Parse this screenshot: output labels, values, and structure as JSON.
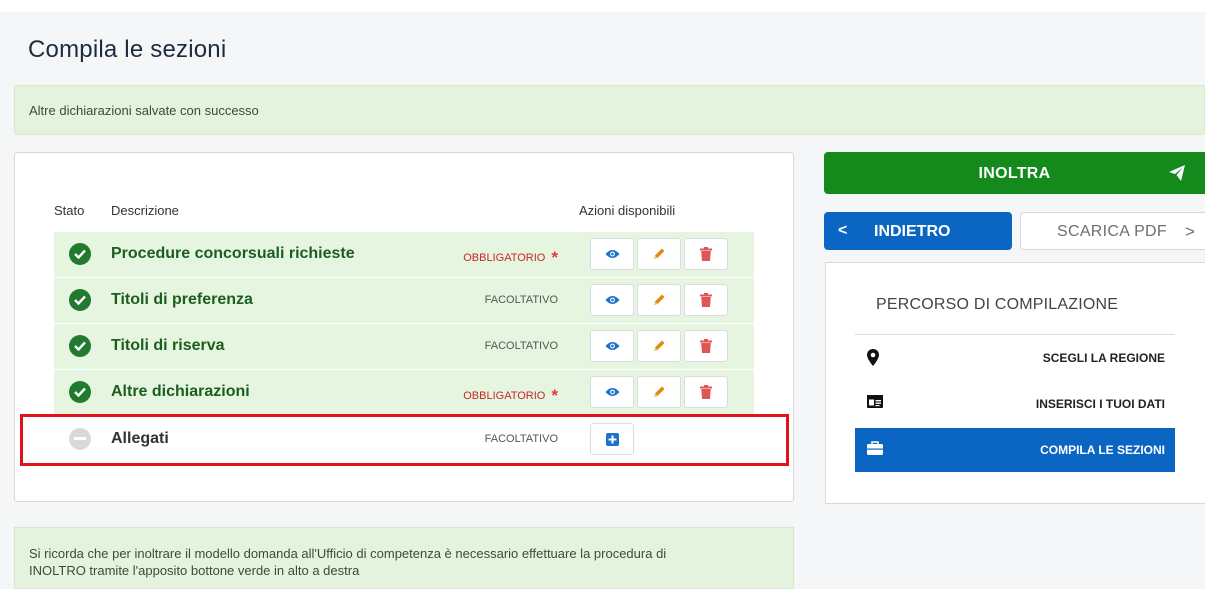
{
  "header": {
    "title": "Compila le sezioni"
  },
  "alert_success": "Altre dichiarazioni salvate con successo",
  "table": {
    "columns": {
      "status": "Stato",
      "description": "Descrizione",
      "actions": "Azioni disponibili"
    },
    "rows": [
      {
        "description": "Procedure concorsuali richieste",
        "requirement": "OBBLIGATORIO",
        "mandatory": true,
        "status": "complete"
      },
      {
        "description": "Titoli di preferenza",
        "requirement": "FACOLTATIVO",
        "mandatory": false,
        "status": "complete"
      },
      {
        "description": "Titoli di riserva",
        "requirement": "FACOLTATIVO",
        "mandatory": false,
        "status": "complete"
      },
      {
        "description": "Altre dichiarazioni",
        "requirement": "OBBLIGATORIO",
        "mandatory": true,
        "status": "complete"
      },
      {
        "description": "Allegati",
        "requirement": "FACOLTATIVO",
        "mandatory": false,
        "status": "empty"
      }
    ],
    "mandatory_marker": "*"
  },
  "alert_info": {
    "line1": "Si ricorda che per inoltrare il modello domanda all'Ufficio di competenza è necessario effettuare la procedura di",
    "line2": "INOLTRO tramite l'apposito bottone verde in alto a destra"
  },
  "sidebar": {
    "inoltra_label": "INOLTRA",
    "back_label": "INDIETRO",
    "back_chevron": "<",
    "pdf_label": "SCARICA PDF",
    "pdf_chevron": ">",
    "percorso_title": "PERCORSO DI COMPILAZIONE",
    "steps": [
      {
        "label": "SCEGLI LA REGIONE",
        "icon": "map-marker-icon",
        "active": false
      },
      {
        "label": "INSERISCI I TUOI DATI",
        "icon": "id-card-icon",
        "active": false
      },
      {
        "label": "COMPILA LE SEZIONI",
        "icon": "briefcase-icon",
        "active": true
      }
    ]
  },
  "colors": {
    "success_green": "#138a1b",
    "primary_blue": "#0a66c2",
    "mandatory_red": "#c62828",
    "row_bg": "#e6f5df",
    "highlight_red": "#e0131a"
  }
}
